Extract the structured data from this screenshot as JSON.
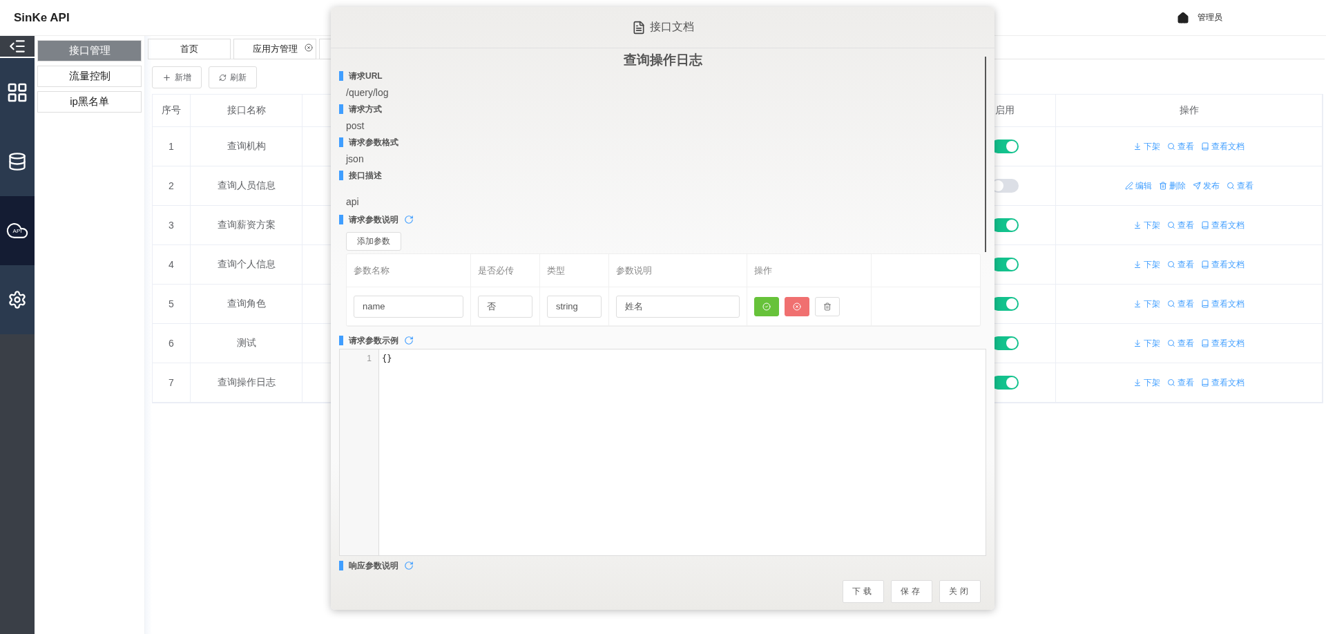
{
  "header": {
    "brand": "SinKe API",
    "user": "管理员"
  },
  "rail": [
    {
      "kind": "menu",
      "selected": false
    },
    {
      "kind": "grid",
      "selected": false
    },
    {
      "kind": "database",
      "selected": false
    },
    {
      "kind": "api",
      "label": "API",
      "selected": true
    },
    {
      "kind": "settings",
      "selected": false
    }
  ],
  "submenu": [
    {
      "label": "接口管理",
      "selected": true
    },
    {
      "label": "流量控制",
      "selected": false
    },
    {
      "label": "ip黑名单",
      "selected": false
    }
  ],
  "tabs": [
    {
      "label": "首页",
      "closable": false
    },
    {
      "label": "应用方管理",
      "closable": true
    }
  ],
  "toolbar": [
    {
      "kind": "add",
      "label": "新增"
    },
    {
      "kind": "refresh",
      "label": "刷新"
    }
  ],
  "table": {
    "columns": [
      "序号",
      "接口名称",
      "启用",
      "操作"
    ],
    "rows": [
      {
        "index": "1",
        "name": "查询机构",
        "enabled": true,
        "actions": [
          {
            "kind": "unpublish",
            "label": "下架"
          },
          {
            "kind": "view",
            "label": "查看"
          },
          {
            "kind": "doc",
            "label": "查看文档"
          }
        ]
      },
      {
        "index": "2",
        "name": "查询人员信息",
        "enabled": false,
        "actions": [
          {
            "kind": "edit",
            "label": "编辑"
          },
          {
            "kind": "delete",
            "label": "删除"
          },
          {
            "kind": "publish",
            "label": "发布"
          },
          {
            "kind": "view",
            "label": "查看"
          }
        ]
      },
      {
        "index": "3",
        "name": "查询薪资方案",
        "enabled": true,
        "actions": [
          {
            "kind": "unpublish",
            "label": "下架"
          },
          {
            "kind": "view",
            "label": "查看"
          },
          {
            "kind": "doc",
            "label": "查看文档"
          }
        ]
      },
      {
        "index": "4",
        "name": "查询个人信息",
        "enabled": true,
        "actions": [
          {
            "kind": "unpublish",
            "label": "下架"
          },
          {
            "kind": "view",
            "label": "查看"
          },
          {
            "kind": "doc",
            "label": "查看文档"
          }
        ]
      },
      {
        "index": "5",
        "name": "查询角色",
        "enabled": true,
        "actions": [
          {
            "kind": "unpublish",
            "label": "下架"
          },
          {
            "kind": "view",
            "label": "查看"
          },
          {
            "kind": "doc",
            "label": "查看文档"
          }
        ]
      },
      {
        "index": "6",
        "name": "测试",
        "enabled": true,
        "actions": [
          {
            "kind": "unpublish",
            "label": "下架"
          },
          {
            "kind": "view",
            "label": "查看"
          },
          {
            "kind": "doc",
            "label": "查看文档"
          }
        ]
      },
      {
        "index": "7",
        "name": "查询操作日志",
        "enabled": true,
        "actions": [
          {
            "kind": "unpublish",
            "label": "下架"
          },
          {
            "kind": "view",
            "label": "查看"
          },
          {
            "kind": "doc",
            "label": "查看文档"
          }
        ]
      }
    ]
  },
  "modal": {
    "title": "接口文档",
    "heading": "查询操作日志",
    "sections": [
      {
        "kind": "text",
        "title": "请求URL",
        "refresh": false,
        "value": "/query/log"
      },
      {
        "kind": "text",
        "title": "请求方式",
        "refresh": false,
        "value": "post"
      },
      {
        "kind": "text",
        "title": "请求参数格式",
        "refresh": false,
        "value": "json"
      },
      {
        "kind": "text",
        "title": "接口描述",
        "refresh": false,
        "value": "api"
      },
      {
        "kind": "params",
        "title": "请求参数说明",
        "refresh": true,
        "add_button": "添加参数",
        "columns": [
          "参数名称",
          "是否必传",
          "类型",
          "参数说明",
          "操作"
        ],
        "rows": [
          {
            "name": "name",
            "required": "否",
            "type": "string",
            "description": "姓名"
          }
        ]
      },
      {
        "kind": "code",
        "title": "请求参数示例",
        "refresh": true,
        "lines": [
          {
            "number": "1",
            "text": "{}"
          }
        ]
      },
      {
        "kind": "heading",
        "title": "响应参数说明",
        "refresh": true
      }
    ],
    "buttons": [
      "下载",
      "保存",
      "关闭"
    ]
  }
}
